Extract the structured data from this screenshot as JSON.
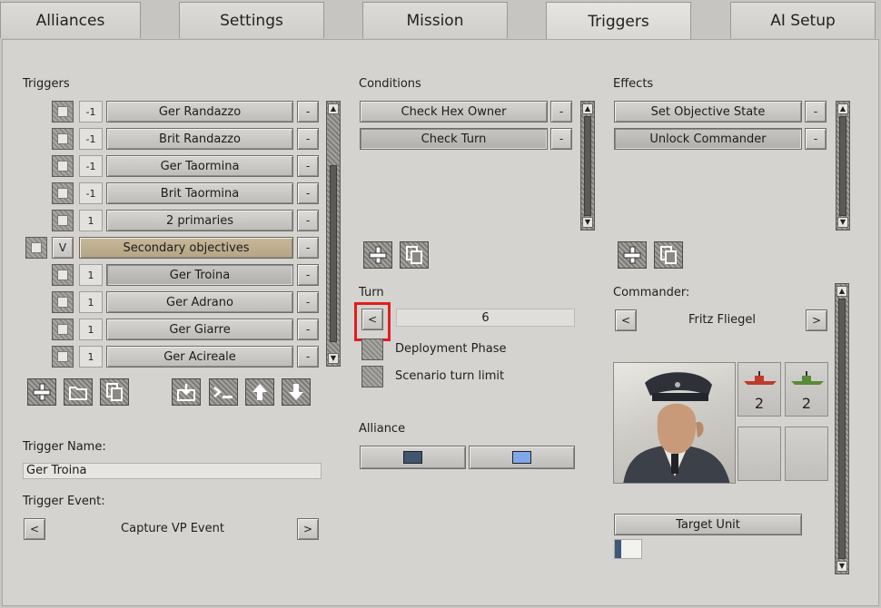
{
  "tabs": [
    {
      "label": "Alliances",
      "active": false
    },
    {
      "label": "Settings",
      "active": false
    },
    {
      "label": "Mission",
      "active": false
    },
    {
      "label": "Triggers",
      "active": true
    },
    {
      "label": "AI Setup",
      "active": false
    }
  ],
  "triggers": {
    "heading": "Triggers",
    "minus_label": "-",
    "items": [
      {
        "num": "-1",
        "label": "Ger Randazzo"
      },
      {
        "num": "-1",
        "label": "Brit Randazzo"
      },
      {
        "num": "-1",
        "label": "Ger Taormina"
      },
      {
        "num": "-1",
        "label": "Brit Taormina"
      },
      {
        "num": "1",
        "label": "2 primaries"
      },
      {
        "num": "V",
        "label": "Secondary objectives"
      },
      {
        "num": "1",
        "label": "Ger Troina"
      },
      {
        "num": "1",
        "label": "Ger Adrano"
      },
      {
        "num": "1",
        "label": "Ger Giarre"
      },
      {
        "num": "1",
        "label": "Ger Acireale"
      }
    ],
    "trigger_name_label": "Trigger Name:",
    "trigger_name_value": "Ger Troina",
    "trigger_event_label": "Trigger Event:",
    "trigger_event_value": "Capture VP Event",
    "prev_label": "<",
    "next_label": ">"
  },
  "conditions": {
    "heading": "Conditions",
    "items": [
      "Check Hex Owner",
      "Check Turn"
    ]
  },
  "effects": {
    "heading": "Effects",
    "items": [
      "Set Objective State",
      "Unlock Commander"
    ]
  },
  "turn": {
    "heading": "Turn",
    "prev_label": "<",
    "value": "6",
    "options": [
      "Deployment Phase",
      "Scenario turn limit"
    ]
  },
  "alliance": {
    "heading": "Alliance",
    "colors": [
      "#3f5570",
      "#7fa8e8"
    ]
  },
  "commander": {
    "heading": "Commander:",
    "name": "Fritz Fliegel",
    "prev_label": "<",
    "next_label": ">",
    "units": [
      {
        "count": "2",
        "color": "#c03a2e"
      },
      {
        "count": "2",
        "color": "#5a8a3a"
      }
    ],
    "target_unit_label": "Target Unit"
  },
  "icons": [
    "add-icon",
    "folder-icon",
    "copy-icon",
    "import-icon",
    "console-icon",
    "arrow-up-icon",
    "arrow-down-icon"
  ]
}
